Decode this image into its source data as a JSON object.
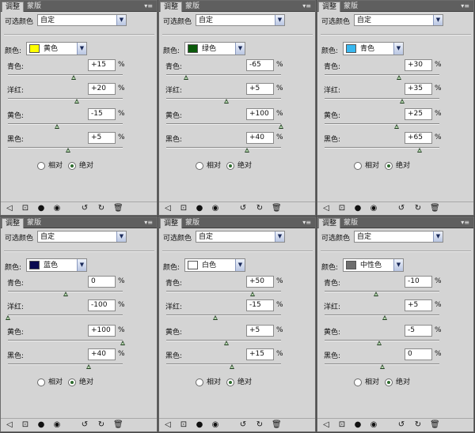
{
  "tabs": {
    "active": "调整",
    "inactive": "蒙版"
  },
  "panel_menu_glyph": "▾≡",
  "preset_label": "可选颜色",
  "preset_value": "自定",
  "colors_label": "颜色:",
  "row_labels": [
    "青色:",
    "洋红:",
    "黄色:",
    "黑色:"
  ],
  "percent_symbol": "%",
  "method_options": {
    "relative": "相对",
    "absolute": "绝对",
    "selected": "absolute"
  },
  "toolbar_icons": [
    "back-arrow-icon",
    "clip-layer-icon",
    "eye-toggle-icon",
    "visibility-icon",
    "view-previous-icon",
    "reset-icon",
    "delete-icon"
  ],
  "panels": [
    {
      "color_name": "黄色",
      "swatch": "#ffff00",
      "values": [
        "+15",
        "+20",
        "-15",
        "+5"
      ]
    },
    {
      "color_name": "绿色",
      "swatch": "#0a5a0a",
      "values": [
        "-65",
        "+5",
        "+100",
        "+40"
      ]
    },
    {
      "color_name": "青色",
      "swatch": "#38b8f0",
      "values": [
        "+30",
        "+35",
        "+25",
        "+65"
      ]
    },
    {
      "color_name": "蓝色",
      "swatch": "#0a0a50",
      "values": [
        "0",
        "-100",
        "+100",
        "+40"
      ]
    },
    {
      "color_name": "白色",
      "swatch": "#ffffff",
      "values": [
        "+50",
        "-15",
        "+5",
        "+15"
      ]
    },
    {
      "color_name": "中性色",
      "swatch": "#6e6e6e",
      "values": [
        "-10",
        "+5",
        "-5",
        "0"
      ]
    }
  ]
}
